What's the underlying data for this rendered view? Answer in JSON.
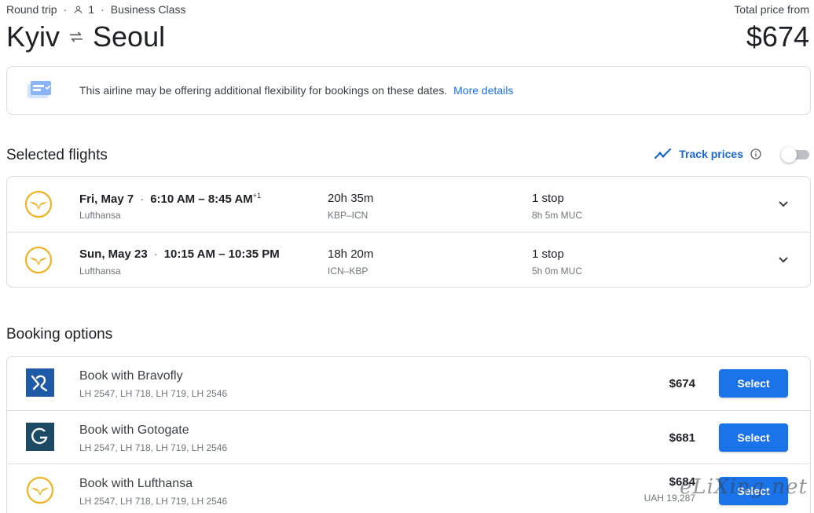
{
  "header": {
    "trip_type": "Round trip",
    "passengers": "1",
    "cabin": "Business Class",
    "total_label": "Total price from",
    "origin": "Kyiv",
    "destination": "Seoul",
    "total_price": "$674"
  },
  "notice": {
    "text": "This airline may be offering additional flexibility for bookings on these dates.",
    "link": "More details"
  },
  "selected_flights": {
    "title": "Selected flights",
    "track_label": "Track prices",
    "track_enabled": false,
    "flights": [
      {
        "date": "Fri, May 7",
        "times": "6:10 AM – 8:45 AM",
        "day_offset": "+1",
        "airline": "Lufthansa",
        "duration": "20h 35m",
        "route": "KBP–ICN",
        "stops": "1 stop",
        "layover": "8h 5m MUC"
      },
      {
        "date": "Sun, May 23",
        "times": "10:15 AM – 10:35 PM",
        "day_offset": "",
        "airline": "Lufthansa",
        "duration": "18h 20m",
        "route": "ICN–KBP",
        "stops": "1 stop",
        "layover": "5h 0m MUC"
      }
    ]
  },
  "booking_options": {
    "title": "Booking options",
    "options": [
      {
        "name": "Book with Bravofly",
        "flights": "LH 2547, LH 718, LH 719, LH 2546",
        "price": "$674",
        "alt_price": "",
        "button": "Select",
        "logo": "bravofly-logo"
      },
      {
        "name": "Book with Gotogate",
        "flights": "LH 2547, LH 718, LH 719, LH 2546",
        "price": "$681",
        "alt_price": "",
        "button": "Select",
        "logo": "gotogate-logo"
      },
      {
        "name": "Book with Lufthansa",
        "flights": "LH 2547, LH 718, LH 719, LH 2546",
        "price": "$684",
        "alt_price": "UAH 19,287",
        "button": "Select",
        "logo": "lufthansa-logo"
      }
    ]
  },
  "watermark": "eLiXing.net",
  "colors": {
    "accent": "#1a73e8",
    "lufthansa_yellow": "#f0b323",
    "bravofly_blue": "#1f5aa6",
    "gotogate_navy": "#1d4964"
  }
}
